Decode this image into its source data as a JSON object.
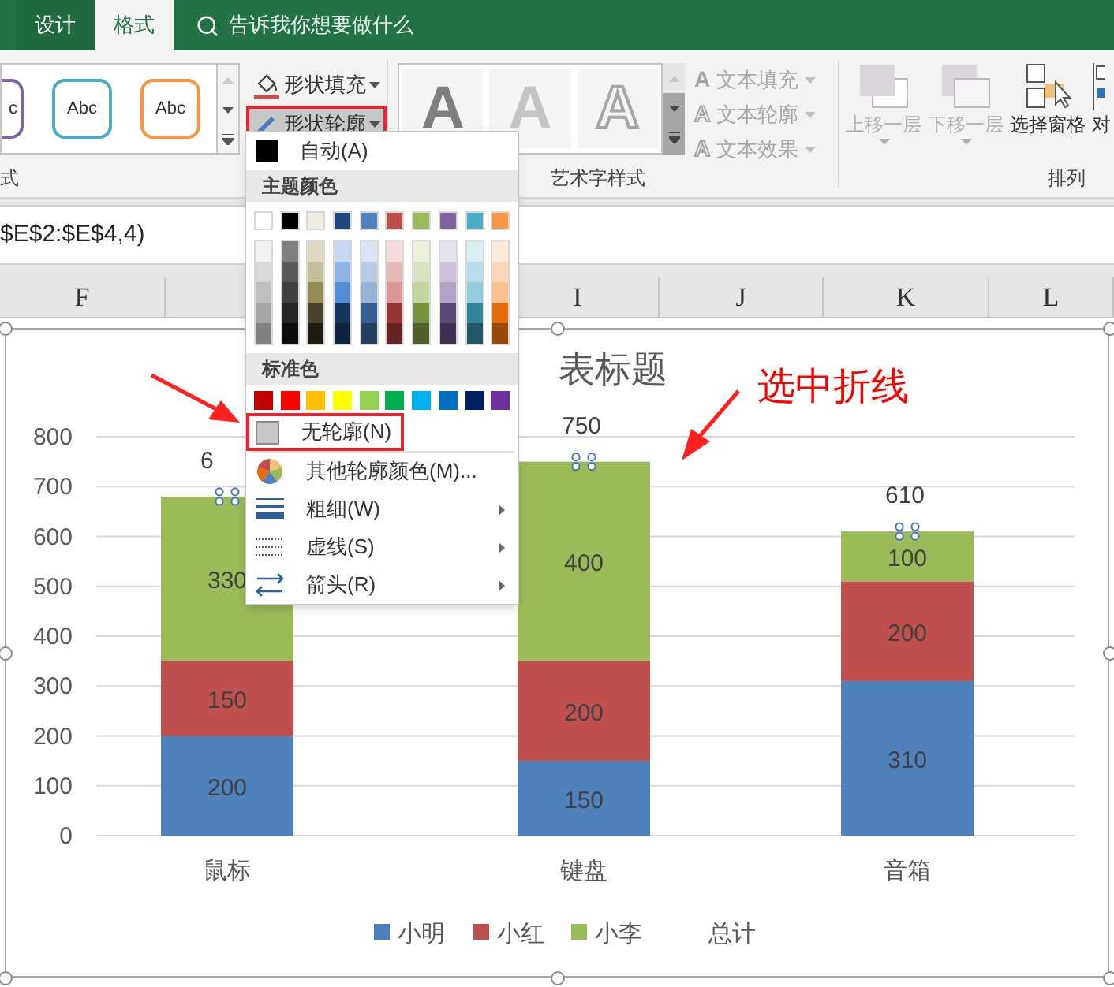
{
  "ribbon_tabs": [
    {
      "label": "设计",
      "selected": false
    },
    {
      "label": "格式",
      "selected": true
    }
  ],
  "tell_me": {
    "placeholder": "告诉我你想要做什么"
  },
  "shape_styles": {
    "samples": [
      {
        "text": "c",
        "kind": "partial",
        "color": "#8064a2"
      },
      {
        "text": "Abc",
        "kind": "full",
        "color": "#4bacc6"
      },
      {
        "text": "Abc",
        "kind": "full",
        "color": "#f79646"
      }
    ],
    "group_label": "式"
  },
  "shape_commands": [
    {
      "label": "形状填充",
      "kind": "fill",
      "highlighted": false
    },
    {
      "label": "形状轮廓",
      "kind": "outline",
      "highlighted": true
    }
  ],
  "wordart_styles": {
    "samples": [
      {
        "text": "A",
        "kind": "filled"
      },
      {
        "text": "A",
        "kind": "light"
      },
      {
        "text": "A",
        "kind": "outline"
      }
    ],
    "group_label": "艺术字样式"
  },
  "text_commands": [
    {
      "glyph": "A",
      "label": "文本填充",
      "kind": "fill",
      "disabled": true
    },
    {
      "glyph": "A",
      "label": "文本轮廓",
      "kind": "outline",
      "disabled": true
    },
    {
      "glyph": "A",
      "label": "文本效果",
      "kind": "effect",
      "disabled": true
    }
  ],
  "arrange": {
    "buttons": [
      {
        "label": "上移一层",
        "kind": "forward",
        "disabled": true
      },
      {
        "label": "下移一层",
        "kind": "backward",
        "disabled": true
      },
      {
        "label": "选择窗格",
        "kind": "pane",
        "disabled": false
      },
      {
        "label": "对",
        "kind": "align",
        "disabled": false
      }
    ],
    "group_label": "排列"
  },
  "formula_bar": {
    "value": "$E$2:$E$4,4)"
  },
  "column_headers": [
    {
      "label": "F"
    },
    {
      "label": "I"
    },
    {
      "label": "J"
    },
    {
      "label": "K"
    },
    {
      "label": "L"
    }
  ],
  "menu": {
    "auto": {
      "label": "自动(A)",
      "color": "#000000"
    },
    "theme_header": "主题颜色",
    "theme_colors": [
      {
        "color": "#ffffff",
        "shades": [
          {
            "color": "#f2f2f2"
          },
          {
            "color": "#d9d9d9"
          },
          {
            "color": "#bfbfbf"
          },
          {
            "color": "#a6a6a6"
          },
          {
            "color": "#808080"
          }
        ]
      },
      {
        "color": "#000000",
        "shades": [
          {
            "color": "#808080"
          },
          {
            "color": "#595959"
          },
          {
            "color": "#404040"
          },
          {
            "color": "#262626"
          },
          {
            "color": "#0d0d0d"
          }
        ]
      },
      {
        "color": "#eeece1",
        "shades": [
          {
            "color": "#ddd9c3"
          },
          {
            "color": "#c4bd97"
          },
          {
            "color": "#948a54"
          },
          {
            "color": "#4a452a"
          },
          {
            "color": "#1e1c11"
          }
        ]
      },
      {
        "color": "#1f497d",
        "shades": [
          {
            "color": "#c6d9f0"
          },
          {
            "color": "#8db3e2"
          },
          {
            "color": "#548dd4"
          },
          {
            "color": "#17365d"
          },
          {
            "color": "#0f243e"
          }
        ]
      },
      {
        "color": "#4f81bd",
        "shades": [
          {
            "color": "#dbe5f1"
          },
          {
            "color": "#b8cce4"
          },
          {
            "color": "#95b3d7"
          },
          {
            "color": "#366092"
          },
          {
            "color": "#244061"
          }
        ]
      },
      {
        "color": "#c0504d",
        "shades": [
          {
            "color": "#f2dcdb"
          },
          {
            "color": "#e5b9b7"
          },
          {
            "color": "#d99694"
          },
          {
            "color": "#953734"
          },
          {
            "color": "#632423"
          }
        ]
      },
      {
        "color": "#9bbb59",
        "shades": [
          {
            "color": "#ebf1dd"
          },
          {
            "color": "#d7e3bc"
          },
          {
            "color": "#c3d69b"
          },
          {
            "color": "#76923c"
          },
          {
            "color": "#4f6128"
          }
        ]
      },
      {
        "color": "#8064a2",
        "shades": [
          {
            "color": "#e5e0ec"
          },
          {
            "color": "#ccc1d9"
          },
          {
            "color": "#b2a2c7"
          },
          {
            "color": "#5f497a"
          },
          {
            "color": "#3f3151"
          }
        ]
      },
      {
        "color": "#4bacc6",
        "shades": [
          {
            "color": "#dbeef3"
          },
          {
            "color": "#b7dde8"
          },
          {
            "color": "#92cddc"
          },
          {
            "color": "#31859b"
          },
          {
            "color": "#205867"
          }
        ]
      },
      {
        "color": "#f79646",
        "shades": [
          {
            "color": "#fdeada"
          },
          {
            "color": "#fbd5b5"
          },
          {
            "color": "#fac08f"
          },
          {
            "color": "#e36c09"
          },
          {
            "color": "#974806"
          }
        ]
      }
    ],
    "standard_header": "标准色",
    "standard_colors": [
      {
        "color": "#c00000"
      },
      {
        "color": "#ff0000"
      },
      {
        "color": "#ffc000"
      },
      {
        "color": "#ffff00"
      },
      {
        "color": "#92d050"
      },
      {
        "color": "#00b050"
      },
      {
        "color": "#00b0f0"
      },
      {
        "color": "#0070c0"
      },
      {
        "color": "#002060"
      },
      {
        "color": "#7030a0"
      }
    ],
    "items": [
      {
        "kind": "no_outline",
        "label": "无轮廓(N)",
        "highlighted": true,
        "submenu": false
      },
      {
        "kind": "more_colors",
        "label": "其他轮廓颜色(M)...",
        "highlighted": false,
        "submenu": false
      },
      {
        "kind": "weight",
        "label": "粗细(W)",
        "highlighted": false,
        "submenu": true
      },
      {
        "kind": "dash",
        "label": "虚线(S)",
        "highlighted": false,
        "submenu": true
      },
      {
        "kind": "arrows",
        "label": "箭头(R)",
        "highlighted": false,
        "submenu": true
      }
    ]
  },
  "annotation": {
    "text": "选中折线"
  },
  "chart": {
    "chart_data": {
      "type": "bar",
      "title": "表标题",
      "categories": [
        "鼠标",
        "键盘",
        "音箱"
      ],
      "series": [
        {
          "name": "小明",
          "color": "#4f81bd",
          "values": [
            200,
            150,
            310
          ]
        },
        {
          "name": "小红",
          "color": "#c0504d",
          "values": [
            150,
            200,
            200
          ]
        },
        {
          "name": "小李",
          "color": "#9bbb59",
          "values": [
            330,
            400,
            100
          ]
        }
      ],
      "stacked": true,
      "grid": true,
      "legend": true,
      "ylim": [
        0,
        800
      ],
      "yticks": [
        0,
        100,
        200,
        300,
        400,
        500,
        600,
        700,
        800
      ],
      "data_labels": true
    },
    "total_line": {
      "name": "总计",
      "selected": true,
      "labels": [
        "6",
        "750",
        "610"
      ]
    }
  }
}
